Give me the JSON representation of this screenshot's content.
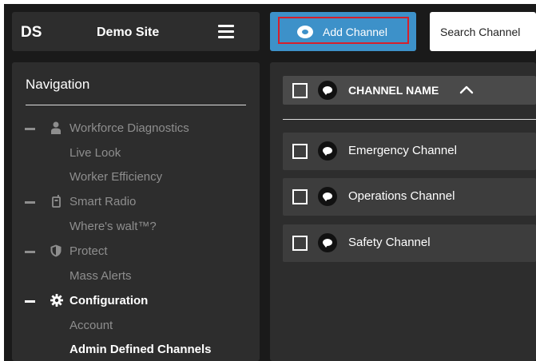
{
  "header": {
    "logo": "DS",
    "site_name": "Demo Site",
    "menu_icon": "hamburger-menu-icon"
  },
  "toolbar": {
    "add_channel_label": "Add Channel",
    "add_channel_icon": "chat-bubble-icon",
    "search_placeholder": "Search Channel"
  },
  "sidebar": {
    "title": "Navigation",
    "items": [
      {
        "label": "Workforce Diagnostics",
        "icon": "person-icon",
        "level": 0,
        "active": false
      },
      {
        "label": "Live Look",
        "level": 1,
        "active": false
      },
      {
        "label": "Worker Efficiency",
        "level": 1,
        "active": false
      },
      {
        "label": "Smart Radio",
        "icon": "radio-icon",
        "level": 0,
        "active": false
      },
      {
        "label": "Where's walt™?",
        "level": 1,
        "active": false
      },
      {
        "label": "Protect",
        "icon": "shield-icon",
        "level": 0,
        "active": false
      },
      {
        "label": "Mass Alerts",
        "level": 1,
        "active": false
      },
      {
        "label": "Configuration",
        "icon": "gear-icon",
        "level": 0,
        "active": true
      },
      {
        "label": "Account",
        "level": 1,
        "active": false
      },
      {
        "label": "Admin Defined Channels",
        "level": 1,
        "active": true
      }
    ]
  },
  "table": {
    "column_header": "CHANNEL NAME",
    "sort": "ascending",
    "rows": [
      {
        "name": "Emergency Channel"
      },
      {
        "name": "Operations Channel"
      },
      {
        "name": "Safety Channel"
      }
    ]
  },
  "colors": {
    "background": "#1a1a1a",
    "panel": "#2d2d2d",
    "accent": "#3d91c9",
    "highlight_box": "#d51f2c",
    "muted_text": "#8e8e8e"
  }
}
